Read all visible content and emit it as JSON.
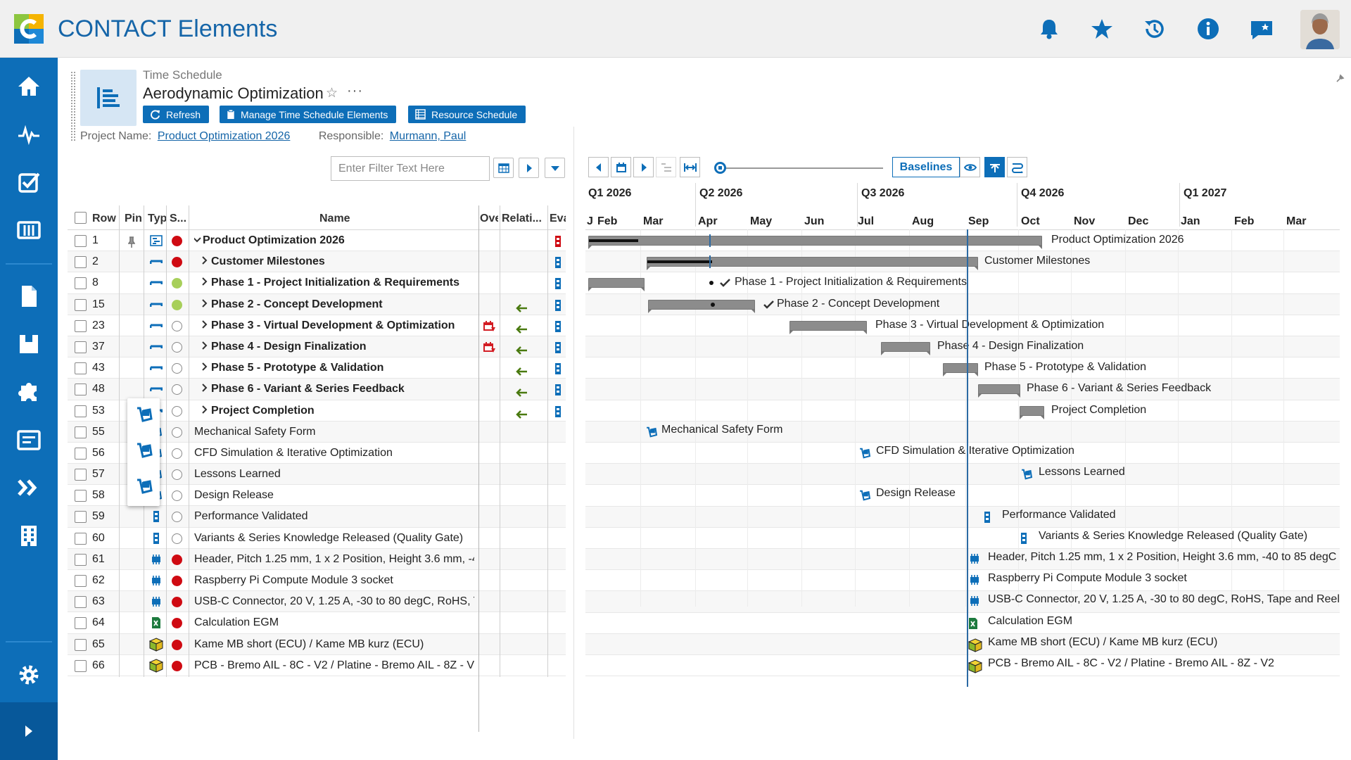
{
  "app": {
    "title": "CONTACT Elements"
  },
  "header": {
    "breadcrumb": "Time Schedule",
    "title": "Aerodynamic Optimization",
    "more": "···",
    "buttons": {
      "refresh": "Refresh",
      "manage": "Manage Time Schedule Elements",
      "resource": "Resource Schedule"
    },
    "project_label": "Project Name:",
    "project_value": "Product Optimization 2026",
    "responsible_label": "Responsible:",
    "responsible_value": "Murmann, Paul"
  },
  "filter": {
    "placeholder": "Enter Filter Text Here"
  },
  "table": {
    "columns": {
      "row": "Row",
      "pin": "Pin",
      "type": "Typ",
      "status": "S...",
      "name": "Name",
      "over": "Ove",
      "relation": "Relati...",
      "eval": "Eva"
    },
    "rows": [
      {
        "row": "1",
        "name": "Product Optimization 2026",
        "status": "red",
        "bold": true,
        "expand": "down",
        "type": "project",
        "pin": true,
        "eval": "red",
        "rel": false,
        "over": false
      },
      {
        "row": "2",
        "name": "Customer Milestones",
        "status": "red",
        "bold": true,
        "expand": "right",
        "type": "task",
        "eval": "blue",
        "rel": false,
        "over": false
      },
      {
        "row": "8",
        "name": "Phase 1 - Project Initialization & Requirements",
        "status": "green",
        "bold": true,
        "expand": "right",
        "type": "task",
        "eval": "blue",
        "rel": false,
        "over": false
      },
      {
        "row": "15",
        "name": "Phase 2 - Concept Development",
        "status": "green",
        "bold": true,
        "expand": "right",
        "type": "task",
        "eval": "blue",
        "rel": true,
        "over": false
      },
      {
        "row": "23",
        "name": "Phase 3 - Virtual Development & Optimization",
        "status": "empty",
        "bold": true,
        "expand": "right",
        "type": "task",
        "eval": "blue",
        "rel": true,
        "over": true
      },
      {
        "row": "37",
        "name": "Phase 4 - Design Finalization",
        "status": "empty",
        "bold": true,
        "expand": "right",
        "type": "task",
        "eval": "blue",
        "rel": true,
        "over": true
      },
      {
        "row": "43",
        "name": "Phase 5 - Prototype & Validation",
        "status": "empty",
        "bold": true,
        "expand": "right",
        "type": "task",
        "eval": "blue",
        "rel": true,
        "over": false
      },
      {
        "row": "48",
        "name": "Phase 6 - Variant & Series Feedback",
        "status": "empty",
        "bold": true,
        "expand": "right",
        "type": "task",
        "eval": "blue",
        "rel": true,
        "over": false
      },
      {
        "row": "53",
        "name": "Project Completion",
        "status": "empty",
        "bold": true,
        "expand": "right",
        "type": "task",
        "eval": "blue",
        "rel": true,
        "over": false
      },
      {
        "row": "55",
        "name": "Mechanical Safety Form",
        "status": "empty",
        "bold": false,
        "type": "checklist"
      },
      {
        "row": "56",
        "name": "CFD Simulation & Iterative Optimization",
        "status": "empty",
        "bold": false,
        "type": "checklist"
      },
      {
        "row": "57",
        "name": "Lessons Learned",
        "status": "empty",
        "bold": false,
        "type": "checklist"
      },
      {
        "row": "58",
        "name": "Design Release",
        "status": "empty",
        "bold": false,
        "type": "checklist"
      },
      {
        "row": "59",
        "name": "Performance Validated",
        "status": "empty",
        "bold": false,
        "type": "milestone"
      },
      {
        "row": "60",
        "name": "Variants & Series Knowledge Released (Quality Gate)",
        "status": "empty",
        "bold": false,
        "type": "milestone"
      },
      {
        "row": "61",
        "name": "Header, Pitch 1.25 mm, 1 x 2 Position, Height 3.6 mm, -40 to 85 degC",
        "status": "red",
        "bold": false,
        "type": "part"
      },
      {
        "row": "62",
        "name": "Raspberry Pi Compute Module 3 socket",
        "status": "red",
        "bold": false,
        "type": "part"
      },
      {
        "row": "63",
        "name": "USB-C Connector, 20 V, 1.25 A, -30 to 80 degC, RoHS, Tape and Reel",
        "status": "red",
        "bold": false,
        "type": "part"
      },
      {
        "row": "64",
        "name": "Calculation EGM",
        "status": "red",
        "bold": false,
        "type": "excel"
      },
      {
        "row": "65",
        "name": "Kame MB short (ECU) / Kame MB kurz (ECU)",
        "status": "red",
        "bold": false,
        "type": "cube"
      },
      {
        "row": "66",
        "name": "PCB - Bremo AIL - 8C - V2 / Platine - Bremo AIL - 8Z - V2",
        "status": "red",
        "bold": false,
        "type": "cube"
      }
    ]
  },
  "gantt": {
    "baselines": "Baselines",
    "quarters": [
      "Q1 2026",
      "Q2 2026",
      "Q3 2026",
      "Q4 2026",
      "Q1 2027"
    ],
    "months": [
      "J",
      "Feb",
      "Mar",
      "Apr",
      "May",
      "Jun",
      "Jul",
      "Aug",
      "Sep",
      "Oct",
      "Nov",
      "Dec",
      "Jan",
      "Feb",
      "Mar"
    ]
  },
  "colors": {
    "brand": "#0d6eb8",
    "status_red": "#cf0a12",
    "status_green": "#a7cf5a"
  }
}
